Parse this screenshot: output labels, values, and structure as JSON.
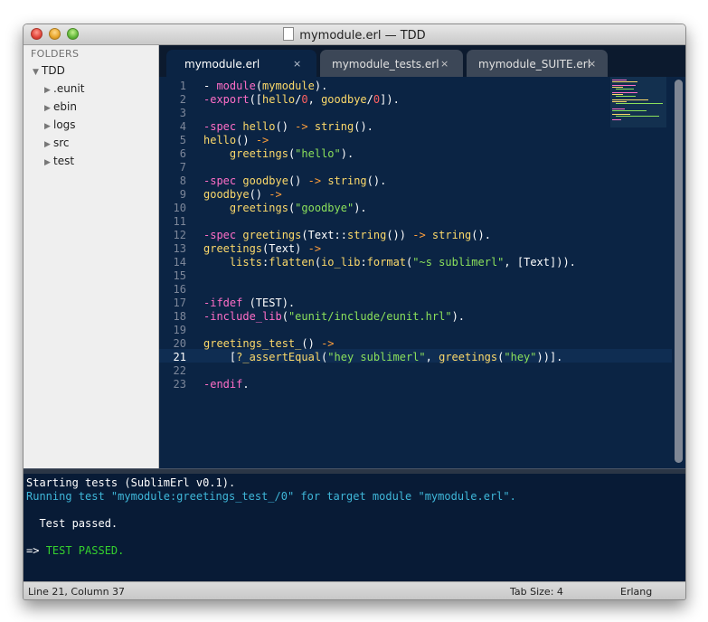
{
  "window": {
    "title": "mymodule.erl — TDD"
  },
  "sidebar": {
    "header": "FOLDERS",
    "root": "TDD",
    "items": [
      ".eunit",
      "ebin",
      "logs",
      "src",
      "test"
    ]
  },
  "tabs": [
    {
      "label": "mymodule.erl",
      "close": "×"
    },
    {
      "label": "mymodule_tests.erl",
      "close": "×"
    },
    {
      "label": "mymodule_SUITE.erl",
      "close": "×"
    }
  ],
  "editor": {
    "line_numbers": [
      "1",
      "2",
      "3",
      "4",
      "5",
      "6",
      "7",
      "8",
      "9",
      "10",
      "11",
      "12",
      "13",
      "14",
      "15",
      "16",
      "17",
      "18",
      "19",
      "20",
      "21",
      "22",
      "23"
    ],
    "current_line": 21,
    "lines": [
      [
        {
          "t": "- ",
          "c": ""
        },
        {
          "t": "module",
          "c": "kw"
        },
        {
          "t": "(",
          "c": ""
        },
        {
          "t": "mymodule",
          "c": "fn"
        },
        {
          "t": ").",
          "c": ""
        }
      ],
      [
        {
          "t": "-export",
          "c": "kw"
        },
        {
          "t": "([",
          "c": ""
        },
        {
          "t": "hello",
          "c": "fn"
        },
        {
          "t": "/",
          "c": ""
        },
        {
          "t": "0",
          "c": "num"
        },
        {
          "t": ", ",
          "c": ""
        },
        {
          "t": "goodbye",
          "c": "fn"
        },
        {
          "t": "/",
          "c": ""
        },
        {
          "t": "0",
          "c": "num"
        },
        {
          "t": "]).",
          "c": ""
        }
      ],
      [],
      [
        {
          "t": "-spec ",
          "c": "kw"
        },
        {
          "t": "hello",
          "c": "fn"
        },
        {
          "t": "() ",
          "c": ""
        },
        {
          "t": "->",
          "c": "op"
        },
        {
          "t": " ",
          "c": ""
        },
        {
          "t": "string",
          "c": "fn"
        },
        {
          "t": "().",
          "c": ""
        }
      ],
      [
        {
          "t": "hello",
          "c": "fn"
        },
        {
          "t": "() ",
          "c": ""
        },
        {
          "t": "->",
          "c": "op"
        }
      ],
      [
        {
          "t": "    ",
          "c": ""
        },
        {
          "t": "greetings",
          "c": "fn"
        },
        {
          "t": "(",
          "c": ""
        },
        {
          "t": "\"hello\"",
          "c": "str"
        },
        {
          "t": ").",
          "c": ""
        }
      ],
      [],
      [
        {
          "t": "-spec ",
          "c": "kw"
        },
        {
          "t": "goodbye",
          "c": "fn"
        },
        {
          "t": "() ",
          "c": ""
        },
        {
          "t": "->",
          "c": "op"
        },
        {
          "t": " ",
          "c": ""
        },
        {
          "t": "string",
          "c": "fn"
        },
        {
          "t": "().",
          "c": ""
        }
      ],
      [
        {
          "t": "goodbye",
          "c": "fn"
        },
        {
          "t": "() ",
          "c": ""
        },
        {
          "t": "->",
          "c": "op"
        }
      ],
      [
        {
          "t": "    ",
          "c": ""
        },
        {
          "t": "greetings",
          "c": "fn"
        },
        {
          "t": "(",
          "c": ""
        },
        {
          "t": "\"goodbye\"",
          "c": "str"
        },
        {
          "t": ").",
          "c": ""
        }
      ],
      [],
      [
        {
          "t": "-spec ",
          "c": "kw"
        },
        {
          "t": "greetings",
          "c": "fn"
        },
        {
          "t": "(Text::",
          "c": ""
        },
        {
          "t": "string",
          "c": "fn"
        },
        {
          "t": "()) ",
          "c": ""
        },
        {
          "t": "->",
          "c": "op"
        },
        {
          "t": " ",
          "c": ""
        },
        {
          "t": "string",
          "c": "fn"
        },
        {
          "t": "().",
          "c": ""
        }
      ],
      [
        {
          "t": "greetings",
          "c": "fn"
        },
        {
          "t": "(Text) ",
          "c": ""
        },
        {
          "t": "->",
          "c": "op"
        }
      ],
      [
        {
          "t": "    ",
          "c": ""
        },
        {
          "t": "lists",
          "c": "fn"
        },
        {
          "t": ":",
          "c": ""
        },
        {
          "t": "flatten",
          "c": "fn"
        },
        {
          "t": "(",
          "c": ""
        },
        {
          "t": "io_lib",
          "c": "fn"
        },
        {
          "t": ":",
          "c": ""
        },
        {
          "t": "format",
          "c": "fn"
        },
        {
          "t": "(",
          "c": ""
        },
        {
          "t": "\"~s sublimerl\"",
          "c": "str"
        },
        {
          "t": ", [Text])).",
          "c": ""
        }
      ],
      [],
      [],
      [
        {
          "t": "-ifdef",
          "c": "kw"
        },
        {
          "t": " (TEST).",
          "c": ""
        }
      ],
      [
        {
          "t": "-include_lib",
          "c": "kw"
        },
        {
          "t": "(",
          "c": ""
        },
        {
          "t": "\"eunit/include/eunit.hrl\"",
          "c": "str"
        },
        {
          "t": ").",
          "c": ""
        }
      ],
      [],
      [
        {
          "t": "greetings_test_",
          "c": "fn"
        },
        {
          "t": "() ",
          "c": ""
        },
        {
          "t": "->",
          "c": "op"
        }
      ],
      [
        {
          "t": "    [",
          "c": ""
        },
        {
          "t": "?_assertEqual",
          "c": "fn"
        },
        {
          "t": "(",
          "c": ""
        },
        {
          "t": "\"hey sublimerl\"",
          "c": "str"
        },
        {
          "t": ", ",
          "c": ""
        },
        {
          "t": "greetings",
          "c": "fn"
        },
        {
          "t": "(",
          "c": ""
        },
        {
          "t": "\"hey\"",
          "c": "str"
        },
        {
          "t": "))].",
          "c": ""
        }
      ],
      [],
      [
        {
          "t": "-endif",
          "c": "kw"
        },
        {
          "t": ".",
          "c": ""
        }
      ]
    ]
  },
  "console": {
    "lines": [
      {
        "text": "Starting tests (SublimErl v0.1).",
        "color": "#ffffff"
      },
      {
        "text": "Running test \"mymodule:greetings_test_/0\" for target module \"mymodule.erl\".",
        "color": "#3fb7d9"
      },
      {
        "text": "",
        "color": "#ffffff"
      },
      {
        "text": "  Test passed.",
        "color": "#ffffff"
      },
      {
        "text": "",
        "color": "#ffffff"
      },
      {
        "text": "=> ",
        "color": "#ffffff",
        "suffix": "TEST PASSED.",
        "suffix_color": "#35d12e"
      }
    ]
  },
  "status": {
    "position": "Line 21, Column 37",
    "tab_size": "Tab Size: 4",
    "syntax": "Erlang"
  }
}
